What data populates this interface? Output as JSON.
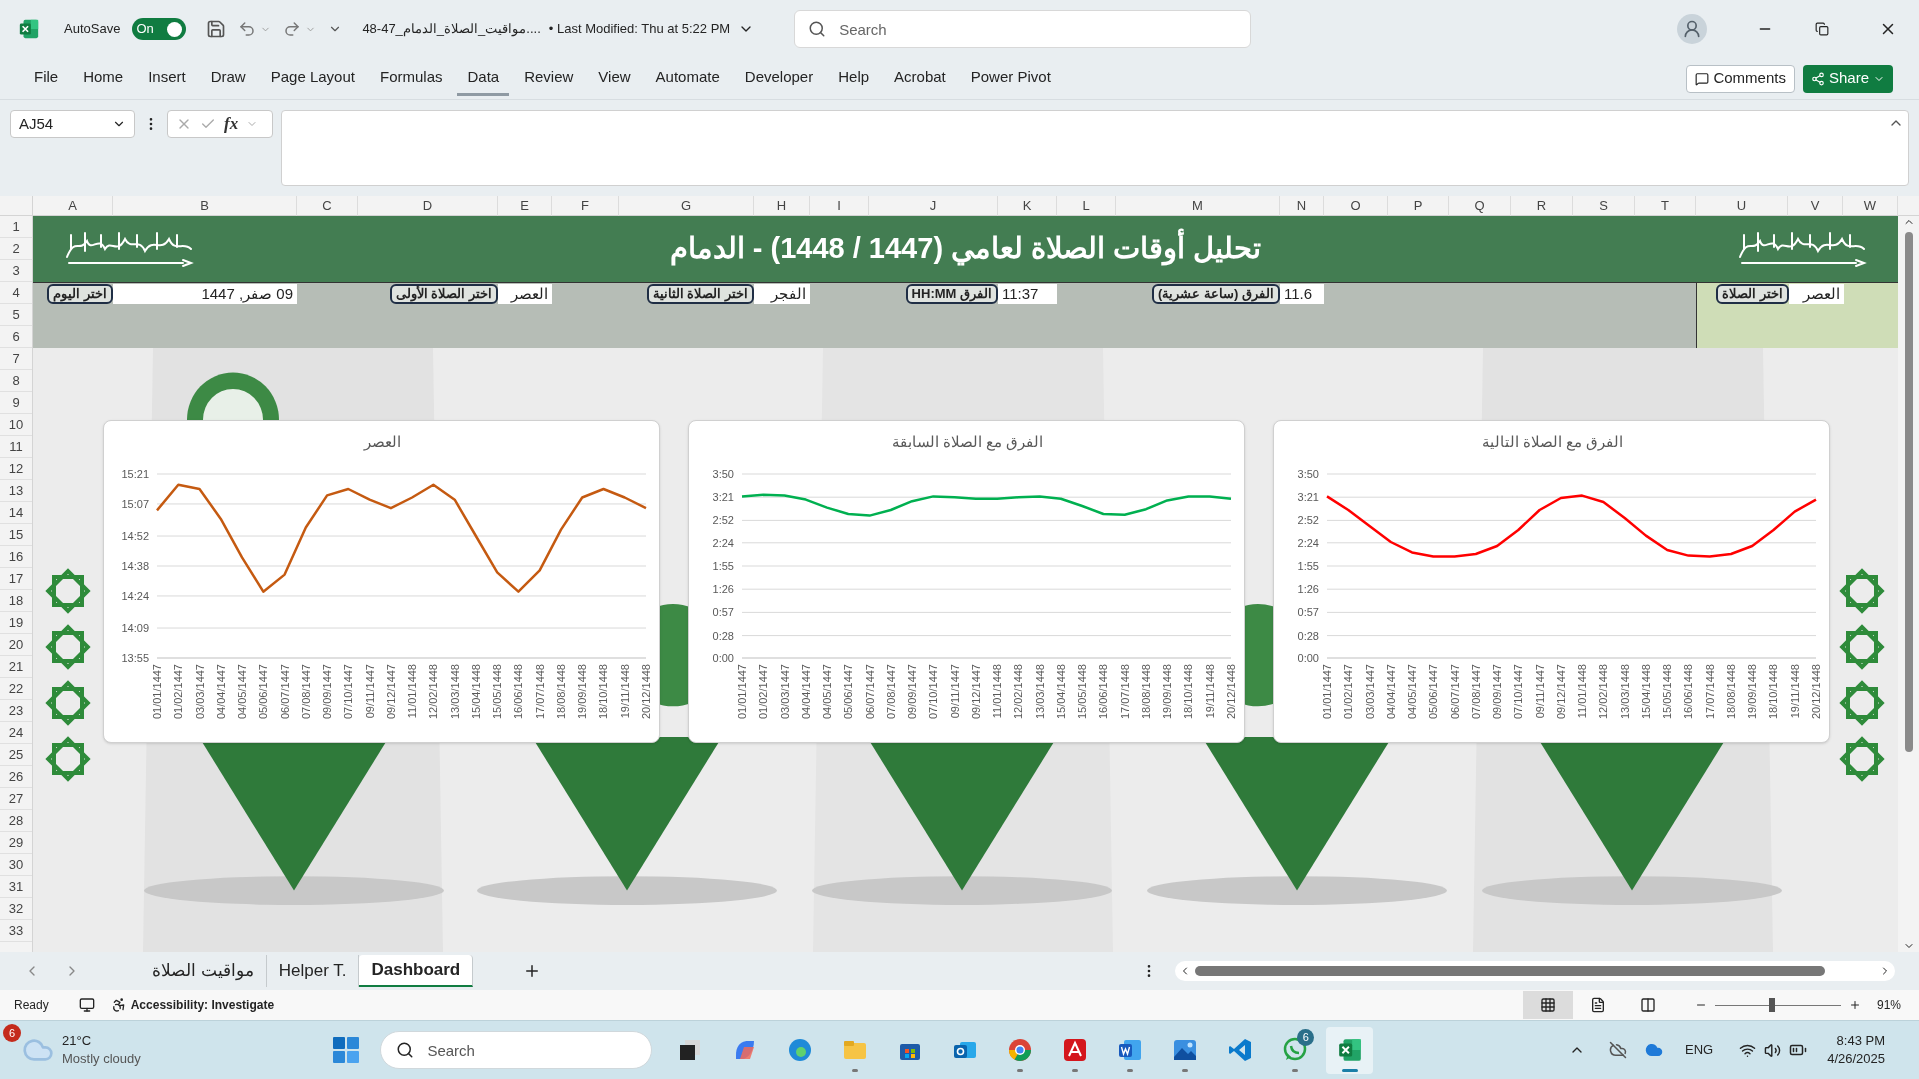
{
  "title_bar": {
    "autosave_label": "AutoSave",
    "autosave": {
      "on": true,
      "label": "On"
    },
    "file_name": "48-47_مواقيت_الصلاة_الدمام....",
    "last_modified": "• Last Modified: Thu at 5:22 PM",
    "search": {
      "placeholder": "Search"
    }
  },
  "ribbon_tabs": [
    {
      "label": "File",
      "selected": false
    },
    {
      "label": "Home",
      "selected": false
    },
    {
      "label": "Insert",
      "selected": false
    },
    {
      "label": "Draw",
      "selected": false
    },
    {
      "label": "Page Layout",
      "selected": false
    },
    {
      "label": "Formulas",
      "selected": false
    },
    {
      "label": "Data",
      "selected": true
    },
    {
      "label": "Review",
      "selected": false
    },
    {
      "label": "View",
      "selected": false
    },
    {
      "label": "Automate",
      "selected": false
    },
    {
      "label": "Developer",
      "selected": false
    },
    {
      "label": "Help",
      "selected": false
    },
    {
      "label": "Acrobat",
      "selected": false
    },
    {
      "label": "Power Pivot",
      "selected": false
    }
  ],
  "ribbon_buttons": {
    "comments": "Comments",
    "share": "Share"
  },
  "formula_bar": {
    "name_box": "AJ54",
    "fx": "fx"
  },
  "columns": [
    "A",
    "B",
    "C",
    "D",
    "E",
    "F",
    "G",
    "H",
    "I",
    "J",
    "K",
    "L",
    "M",
    "N",
    "O",
    "P",
    "Q",
    "R",
    "S",
    "T",
    "U",
    "V",
    "W"
  ],
  "rows": [
    "1",
    "2",
    "3",
    "4",
    "5",
    "6",
    "7",
    "8",
    "9",
    "10",
    "11",
    "12",
    "13",
    "14",
    "15",
    "16",
    "17",
    "18",
    "19",
    "20",
    "21",
    "22",
    "23",
    "24",
    "25",
    "26",
    "27",
    "28",
    "29",
    "30",
    "31",
    "32",
    "33"
  ],
  "dashboard": {
    "title": "تحليل أوقات الصلاة لعامي (1447 / 1448) - الدمام",
    "prayer_selector": {
      "label": "اختر الصلاة",
      "value": "العصر"
    },
    "controls": [
      {
        "label": "الفرق (ساعة عشرية)",
        "value": "11.6"
      },
      {
        "label": "الفرق HH:MM",
        "value": "11:37"
      },
      {
        "label": "اختر الصلاة الثانية",
        "value": "الفجر"
      },
      {
        "label": "اختر الصلاة الأولى",
        "value": "العصر"
      },
      {
        "label": "اختر اليوم",
        "value": "09 صفر, 1447"
      }
    ],
    "charts": [
      {
        "chart_data": {
          "type": "line",
          "grid": true,
          "title": "الفرق مع الصلاة التالية",
          "categories": [
            "01/01/1447",
            "01/02/1447",
            "03/03/1447",
            "04/04/1447",
            "04/05/1447",
            "05/06/1447",
            "06/07/1447",
            "07/08/1447",
            "09/09/1447",
            "07/10/1447",
            "09/11/1447",
            "09/12/1447",
            "11/01/1448",
            "12/02/1448",
            "13/03/1448",
            "15/04/1448",
            "15/05/1448",
            "16/06/1448",
            "17/07/1448",
            "18/08/1448",
            "19/09/1448",
            "18/10/1448",
            "19/11/1448",
            "20/12/1448"
          ],
          "ylim": [
            0,
            230
          ],
          "yticks": [
            {
              "value": 230,
              "label": "3:50"
            },
            {
              "value": 201,
              "label": "3:21"
            },
            {
              "value": 172,
              "label": "2:52"
            },
            {
              "value": 144,
              "label": "2:24"
            },
            {
              "value": 115,
              "label": "1:55"
            },
            {
              "value": 86,
              "label": "1:26"
            },
            {
              "value": 57,
              "label": "0:57"
            },
            {
              "value": 28,
              "label": "0:28"
            },
            {
              "value": 0,
              "label": "0:00"
            }
          ],
          "series": [
            {
              "color": "#ff0000",
              "values": [
                202,
                185,
                165,
                145,
                132,
                127,
                127,
                130,
                140,
                160,
                185,
                200,
                203,
                195,
                175,
                153,
                135,
                128,
                127,
                130,
                140,
                160,
                183,
                198
              ]
            }
          ]
        }
      },
      {
        "chart_data": {
          "type": "line",
          "grid": true,
          "title": "الفرق مع الصلاة السابقة",
          "categories": [
            "01/01/1447",
            "01/02/1447",
            "03/03/1447",
            "04/04/1447",
            "04/05/1447",
            "05/06/1447",
            "06/07/1447",
            "07/08/1447",
            "09/09/1447",
            "07/10/1447",
            "09/11/1447",
            "09/12/1447",
            "11/01/1448",
            "12/02/1448",
            "13/03/1448",
            "15/04/1448",
            "15/05/1448",
            "16/06/1448",
            "17/07/1448",
            "18/08/1448",
            "19/09/1448",
            "18/10/1448",
            "19/11/1448",
            "20/12/1448"
          ],
          "ylim": [
            0,
            230
          ],
          "yticks": [
            {
              "value": 230,
              "label": "3:50"
            },
            {
              "value": 201,
              "label": "3:21"
            },
            {
              "value": 172,
              "label": "2:52"
            },
            {
              "value": 144,
              "label": "2:24"
            },
            {
              "value": 115,
              "label": "1:55"
            },
            {
              "value": 86,
              "label": "1:26"
            },
            {
              "value": 57,
              "label": "0:57"
            },
            {
              "value": 28,
              "label": "0:28"
            },
            {
              "value": 0,
              "label": "0:00"
            }
          ],
          "series": [
            {
              "color": "#00b050",
              "values": [
                202,
                204,
                203,
                198,
                188,
                180,
                178,
                185,
                196,
                202,
                201,
                199,
                199,
                201,
                202,
                199,
                190,
                180,
                179,
                186,
                197,
                202,
                202,
                199
              ]
            }
          ]
        }
      },
      {
        "chart_data": {
          "type": "line",
          "grid": true,
          "title": "العصر",
          "categories": [
            "01/01/1447",
            "01/02/1447",
            "03/03/1447",
            "04/04/1447",
            "04/05/1447",
            "05/06/1447",
            "06/07/1447",
            "07/08/1447",
            "09/09/1447",
            "07/10/1447",
            "09/11/1447",
            "09/12/1447",
            "11/01/1448",
            "12/02/1448",
            "13/03/1448",
            "15/04/1448",
            "15/05/1448",
            "16/06/1448",
            "17/07/1448",
            "18/08/1448",
            "19/09/1448",
            "18/10/1448",
            "19/11/1448",
            "20/12/1448"
          ],
          "ylim": [
            835,
            921
          ],
          "yticks": [
            {
              "value": 921,
              "label": "15:21"
            },
            {
              "value": 907,
              "label": "15:07"
            },
            {
              "value": 892,
              "label": "14:52"
            },
            {
              "value": 878,
              "label": "14:38"
            },
            {
              "value": 864,
              "label": "14:24"
            },
            {
              "value": 849,
              "label": "14:09"
            },
            {
              "value": 835,
              "label": "13:55"
            }
          ],
          "series": [
            {
              "color": "#c55a11",
              "values": [
                904,
                916,
                914,
                900,
                882,
                866,
                874,
                896,
                911,
                914,
                909,
                905,
                910,
                916,
                909,
                892,
                875,
                866,
                876,
                895,
                910,
                914,
                910,
                905
              ]
            }
          ]
        }
      }
    ]
  },
  "sheet_tabs": [
    {
      "label": "مواقيت الصلاة",
      "selected": false
    },
    {
      "label": "Helper T.",
      "selected": false
    },
    {
      "label": "Dashboard",
      "selected": true
    }
  ],
  "status_bar": {
    "ready": "Ready",
    "accessibility": "Accessibility: Investigate",
    "view_buttons": [
      {
        "kind": "normal",
        "selected": true
      },
      {
        "kind": "page_layout",
        "selected": false
      },
      {
        "kind": "page_break",
        "selected": false
      }
    ],
    "zoom": {
      "level": 0.45,
      "reading": "91%"
    }
  },
  "taskbar": {
    "weather": {
      "badge": "6",
      "temperature": "21°C",
      "condition": "Mostly cloudy"
    },
    "search": {
      "placeholder": "Search"
    },
    "apps": [
      {
        "kind": "taskview",
        "running": false,
        "active": false
      },
      {
        "kind": "copilot",
        "running": false,
        "active": false
      },
      {
        "kind": "edge",
        "running": false,
        "active": false
      },
      {
        "kind": "explorer",
        "running": true,
        "active": false
      },
      {
        "kind": "store",
        "running": false,
        "active": false
      },
      {
        "kind": "outlook",
        "running": false,
        "active": false
      },
      {
        "kind": "chrome",
        "running": true,
        "active": false
      },
      {
        "kind": "acrobat",
        "running": true,
        "active": false
      },
      {
        "kind": "word",
        "running": true,
        "active": false
      },
      {
        "kind": "photos",
        "running": true,
        "active": false
      },
      {
        "kind": "vscode",
        "running": false,
        "active": false
      },
      {
        "kind": "whatsapp",
        "running": true,
        "active": false,
        "badge": "6"
      },
      {
        "kind": "excel",
        "running": true,
        "active": true
      }
    ],
    "language": "ENG",
    "time": "8:43 PM",
    "date": "4/26/2025"
  }
}
